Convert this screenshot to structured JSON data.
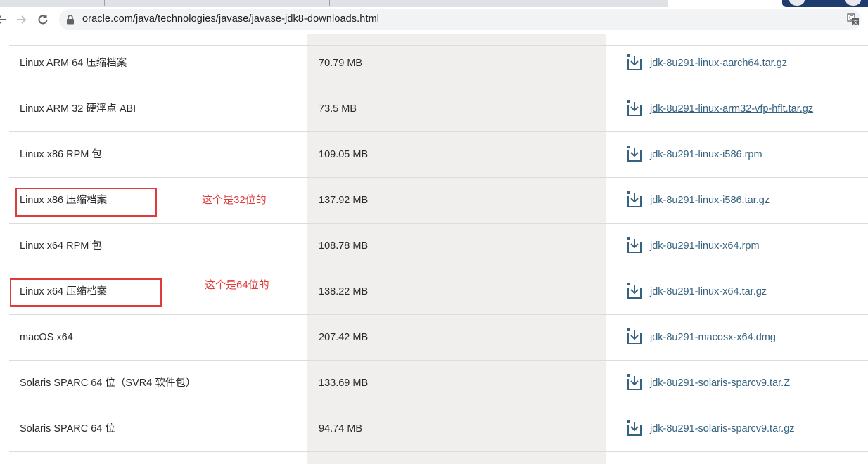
{
  "browser": {
    "url": "oracle.com/java/technologies/javase/javase-jdk8-downloads.html",
    "accent_color": "#346280",
    "annotation_color": "#e03b3b"
  },
  "downloads": [
    {
      "product": "Linux ARM 64 压缩档案",
      "size": "70.79 MB",
      "file": "jdk-8u291-linux-aarch64.tar.gz"
    },
    {
      "product": "Linux ARM 32 硬浮点 ABI",
      "size": "73.5 MB",
      "file": "jdk-8u291-linux-arm32-vfp-hflt.tar.gz"
    },
    {
      "product": "Linux x86 RPM 包",
      "size": "109.05 MB",
      "file": "jdk-8u291-linux-i586.rpm"
    },
    {
      "product": "Linux x86 压缩档案",
      "size": "137.92 MB",
      "file": "jdk-8u291-linux-i586.tar.gz"
    },
    {
      "product": "Linux x64 RPM 包",
      "size": "108.78 MB",
      "file": "jdk-8u291-linux-x64.rpm"
    },
    {
      "product": "Linux x64 压缩档案",
      "size": "138.22 MB",
      "file": "jdk-8u291-linux-x64.tar.gz"
    },
    {
      "product": "macOS x64",
      "size": "207.42 MB",
      "file": "jdk-8u291-macosx-x64.dmg"
    },
    {
      "product": "Solaris SPARC 64 位（SVR4 软件包）",
      "size": "133.69 MB",
      "file": "jdk-8u291-solaris-sparcv9.tar.Z"
    },
    {
      "product": "Solaris SPARC 64 位",
      "size": "94.74 MB",
      "file": "jdk-8u291-solaris-sparcv9.tar.gz"
    }
  ],
  "annotations": {
    "note_32bit": "这个是32位的",
    "note_64bit": "这个是64位的"
  }
}
